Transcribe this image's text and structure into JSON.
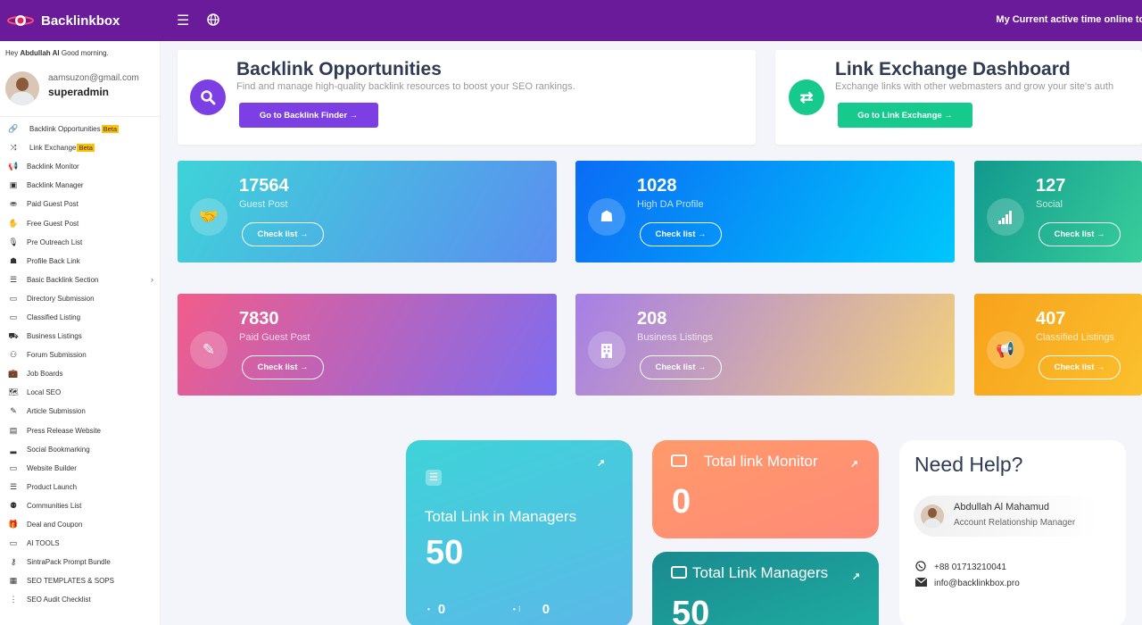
{
  "brand": {
    "name": "Backlinkbox"
  },
  "header": {
    "active_time": "My Current active time online tod"
  },
  "user": {
    "greeting_prefix": "Hey",
    "name": "Abdullah Al",
    "greeting_suffix": "Good morning.",
    "email": "aamsuzon@gmail.com",
    "role": "superadmin"
  },
  "sidebar": {
    "items": [
      {
        "label": "Backlink Opportunities",
        "icon": "link-icon",
        "glyph": "🔗",
        "badge": "Beta"
      },
      {
        "label": "Link Exchange",
        "icon": "shuffle-icon",
        "glyph": "⤨",
        "badge": "Beta"
      },
      {
        "label": "Backlink Monitor",
        "icon": "bullhorn-icon",
        "glyph": "📢"
      },
      {
        "label": "Backlink Manager",
        "icon": "save-icon",
        "glyph": "▣"
      },
      {
        "label": "Paid Guest Post",
        "icon": "coins-icon",
        "glyph": "⛂"
      },
      {
        "label": "Free Guest Post",
        "icon": "handshake-icon",
        "glyph": "✋"
      },
      {
        "label": "Pre Outreach List",
        "icon": "microphone-icon",
        "glyph": "🎙"
      },
      {
        "label": "Profile Back Link",
        "icon": "user-secret-icon",
        "glyph": "☗"
      },
      {
        "label": "Basic Backlink Section",
        "icon": "list-icon",
        "glyph": "☰",
        "chevron": "›"
      },
      {
        "label": "Directory Submission",
        "icon": "desktop-icon",
        "glyph": "▭"
      },
      {
        "label": "Classified Listing",
        "icon": "laptop-icon",
        "glyph": "▭"
      },
      {
        "label": "Business Listings",
        "icon": "dolly-icon",
        "glyph": "⛟"
      },
      {
        "label": "Forum Submission",
        "icon": "people-icon",
        "glyph": "⚇"
      },
      {
        "label": "Job Boards",
        "icon": "briefcase-icon",
        "glyph": "💼"
      },
      {
        "label": "Local SEO",
        "icon": "map-icon",
        "glyph": "🗺"
      },
      {
        "label": "Article Submission",
        "icon": "pencil-icon",
        "glyph": "✎"
      },
      {
        "label": "Press Release Website",
        "icon": "newspaper-icon",
        "glyph": "▤"
      },
      {
        "label": "Social Bookmarking",
        "icon": "signal-icon",
        "glyph": "▂"
      },
      {
        "label": "Website Builder",
        "icon": "laptop-icon",
        "glyph": "▭"
      },
      {
        "label": "Product Launch",
        "icon": "list-icon",
        "glyph": "☰"
      },
      {
        "label": "Communities List",
        "icon": "users-icon",
        "glyph": "⚉"
      },
      {
        "label": "Deal and Coupon",
        "icon": "gift-icon",
        "glyph": "🎁"
      },
      {
        "label": "AI TOOLS",
        "icon": "desktop-icon",
        "glyph": "▭"
      },
      {
        "label": "SintraPack Prompt Bundle",
        "icon": "key-icon",
        "glyph": "⚷"
      },
      {
        "label": "SEO TEMPLATES & SOPS",
        "icon": "grid-icon",
        "glyph": "▦"
      },
      {
        "label": "SEO Audit Checklist",
        "icon": "ellipsis-vertical-icon",
        "glyph": "⋮"
      }
    ]
  },
  "opportunities": {
    "title": "Backlink Opportunities",
    "subtitle": "Find and manage high-quality backlink resources to boost your SEO rankings.",
    "button": "Go to Backlink Finder →",
    "icon": "search-icon"
  },
  "exchange": {
    "title": "Link Exchange Dashboard",
    "subtitle": "Exchange links with other webmasters and grow your site's auth",
    "button": "Go to Link Exchange →",
    "icon": "swap-icon"
  },
  "stats": [
    {
      "value": "17564",
      "label": "Guest Post",
      "button": "Check list →",
      "icon": "handshake-icon"
    },
    {
      "value": "1028",
      "label": "High DA Profile",
      "button": "Check list →",
      "icon": "user-secret-icon"
    },
    {
      "value": "127",
      "label": "Social",
      "button": "Check list →",
      "icon": "signal-icon"
    },
    {
      "value": "7830",
      "label": "Paid Guest Post",
      "button": "Check list →",
      "icon": "pencil-icon"
    },
    {
      "value": "208",
      "label": "Business Listings",
      "button": "Check list →",
      "icon": "building-icon"
    },
    {
      "value": "407",
      "label": "Classified Listings",
      "button": "Check list →",
      "icon": "bullhorn-icon"
    }
  ],
  "summary": {
    "managers": {
      "title": "Total Link in Managers",
      "value": "50",
      "sub_a": "0",
      "sub_b": "0"
    },
    "monitor": {
      "title": "Total link Monitor",
      "value": "0"
    },
    "link_managers": {
      "title": "Total Link Managers",
      "value": "50"
    }
  },
  "help": {
    "title": "Need Help?",
    "manager_name": "Abdullah Al Mahamud",
    "manager_role": "Account Relationship Manager",
    "phone": "+88 01713210041",
    "email": "info@backlinkbox.pro"
  },
  "colors": {
    "topbar": "#6a1b9a",
    "accent_purple": "#7b3fe4",
    "accent_green": "#16c98d",
    "beta": "#ffc107"
  }
}
